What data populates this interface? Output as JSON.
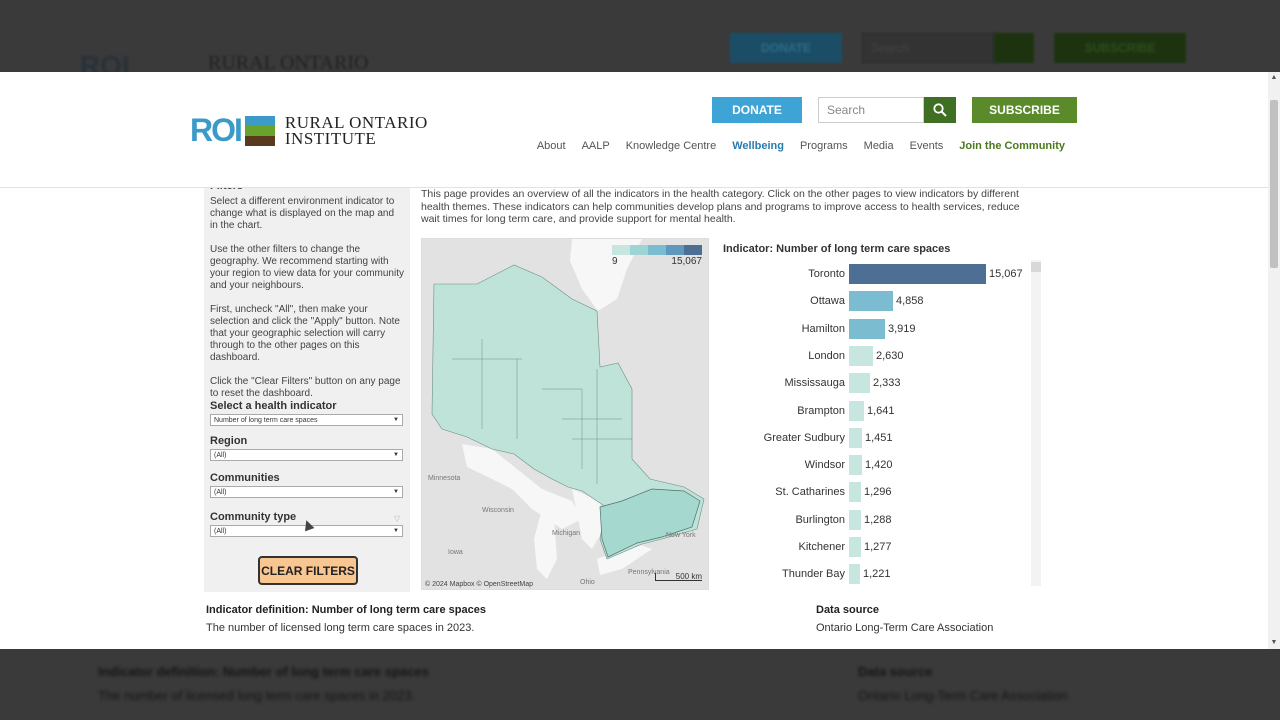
{
  "background": {
    "logo_text": "RURAL ONTARIO",
    "donate": "DONATE",
    "search_placeholder": "Search",
    "subscribe": "SUBSCRIBE",
    "definition_title": "Indicator definition: Number of long term care spaces",
    "definition_text": "The number of licensed long term care spaces in 2023.",
    "source_title": "Data source",
    "source_text": "Ontario Long-Term Care Association"
  },
  "header": {
    "logo_abbr": "ROI",
    "logo_line1": "RURAL ONTARIO",
    "logo_line2": "INSTITUTE",
    "donate": "DONATE",
    "search_placeholder": "Search",
    "subscribe": "SUBSCRIBE",
    "nav": [
      "About",
      "AALP",
      "Knowledge Centre",
      "Wellbeing",
      "Programs",
      "Media",
      "Events",
      "Join the Community"
    ],
    "active_nav": "Wellbeing"
  },
  "filters": {
    "title": "Filters",
    "p1": "Select a different environment indicator to change what is displayed on the map and in the chart.",
    "p2": "Use the other filters to change the geography. We recommend starting with your region to view data for your community and your neighbours.",
    "p3": "First, uncheck \"All\", then make your selection and click the \"Apply\" button. Note that your geographic selection will carry through to the other pages on this dashboard.",
    "p4": "Click the \"Clear Filters\" button on any page to reset the dashboard.",
    "indicator_label": "Select a health indicator",
    "indicator_value": "Number of long term care spaces",
    "region_label": "Region",
    "region_value": "(All)",
    "communities_label": "Communities",
    "communities_value": "(All)",
    "community_type_label": "Community type",
    "community_type_value": "(All)",
    "clear_button": "CLEAR FILTERS"
  },
  "intro": "This page provides an overview of all the indicators in the health category. Click on the other pages to view indicators by different health themes. These indicators can help communities develop plans and programs to improve access to health services, reduce wait times for long term care, and provide support for mental health.",
  "map": {
    "legend_min": "9",
    "legend_max": "15,067",
    "legend_colors": [
      "#c8e6e0",
      "#9fd4d4",
      "#7cbcd0",
      "#5e98bc",
      "#4d6f94"
    ],
    "places": [
      "Minnesota",
      "Wisconsin",
      "Michigan",
      "Iowa",
      "New York",
      "Pennsylvania",
      "Ohio"
    ],
    "attribution": "© 2024 Mapbox  © OpenStreetMap",
    "scale": "500 km"
  },
  "chart_data": {
    "type": "bar",
    "title": "Indicator: Number of long term care spaces",
    "categories": [
      "Toronto",
      "Ottawa",
      "Hamilton",
      "London",
      "Mississauga",
      "Brampton",
      "Greater Sudbury",
      "Windsor",
      "St. Catharines",
      "Burlington",
      "Kitchener",
      "Thunder Bay"
    ],
    "values": [
      15067,
      4858,
      3919,
      2630,
      2333,
      1641,
      1451,
      1420,
      1296,
      1288,
      1277,
      1221
    ],
    "labels": [
      "15,067",
      "4,858",
      "3,919",
      "2,630",
      "2,333",
      "1,641",
      "1,451",
      "1,420",
      "1,296",
      "1,288",
      "1,277",
      "1,221"
    ],
    "orientation": "horizontal",
    "xlim": [
      0,
      15067
    ]
  },
  "definition": {
    "title": "Indicator definition: Number of long term care spaces",
    "text": "The number of licensed long term care spaces in 2023."
  },
  "source": {
    "title": "Data source",
    "text": "Ontario Long-Term Care Association"
  }
}
